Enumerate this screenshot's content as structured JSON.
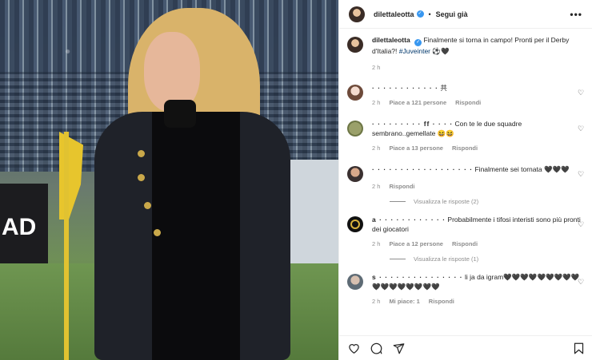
{
  "post": {
    "username": "dilettaleotta",
    "follow_label": "Segui già",
    "separator": "•",
    "more_label": "•••",
    "caption": {
      "username": "dilettaleotta",
      "text": "Finalmente si torna in campo! Pronti per il Derby d'Italia?!",
      "hashtag": "#Juveinter",
      "emoji": "⚽️🖤",
      "time": "2 h"
    },
    "photo": {
      "board_text": "AD"
    }
  },
  "comments": [
    {
      "user": "· · · · · · · · · · · ·",
      "text": "共",
      "time": "2 h",
      "likes": "Piace a 121 persone",
      "reply": "Rispondi",
      "avatar": "user-avatar-icon"
    },
    {
      "user": "· · ·  · · · · · · ff · · ·  ·",
      "text": "Con te le due squadre sembrano..gemellate 😆😆",
      "time": "2 h",
      "likes": "Piace a 13 persone",
      "reply": "Rispondi",
      "avatar": "user-avatar-icon"
    },
    {
      "user": "· · · · · · · · · · · · · · · · · ·",
      "text": "Finalmente sei tornata 🖤🖤🖤",
      "time": "2 h",
      "likes": "",
      "reply": "Rispondi",
      "view_replies": "Visualizza le risposte (2)",
      "avatar": "user-avatar-icon"
    },
    {
      "user": "a · · · · · · · · · · · ·",
      "text": "Probabilmente i tifosi interisti sono più pronti dei giocatori",
      "time": "2 h",
      "likes": "Piace a 12 persone",
      "reply": "Rispondi",
      "view_replies": "Visualizza le risposte (1)",
      "avatar": "inter-logo-icon"
    },
    {
      "user": "s · · · · · · · · · · · · · · ·",
      "text": "li ja da igram🖤🖤🖤🖤🖤🖤🖤🖤🖤🖤🖤🖤🖤🖤🖤🖤🖤",
      "time": "2 h",
      "likes": "Mi piace: 1",
      "reply": "Rispondi",
      "avatar": "user-avatar-icon"
    }
  ],
  "icons": {
    "like": "heart-icon",
    "comment": "comment-icon",
    "share": "share-icon",
    "save": "bookmark-icon",
    "verified": "verified-badge-icon"
  },
  "colors": {
    "verified": "#3897f0",
    "meta_text": "#8e8e8e",
    "hashtag": "#00376b"
  }
}
